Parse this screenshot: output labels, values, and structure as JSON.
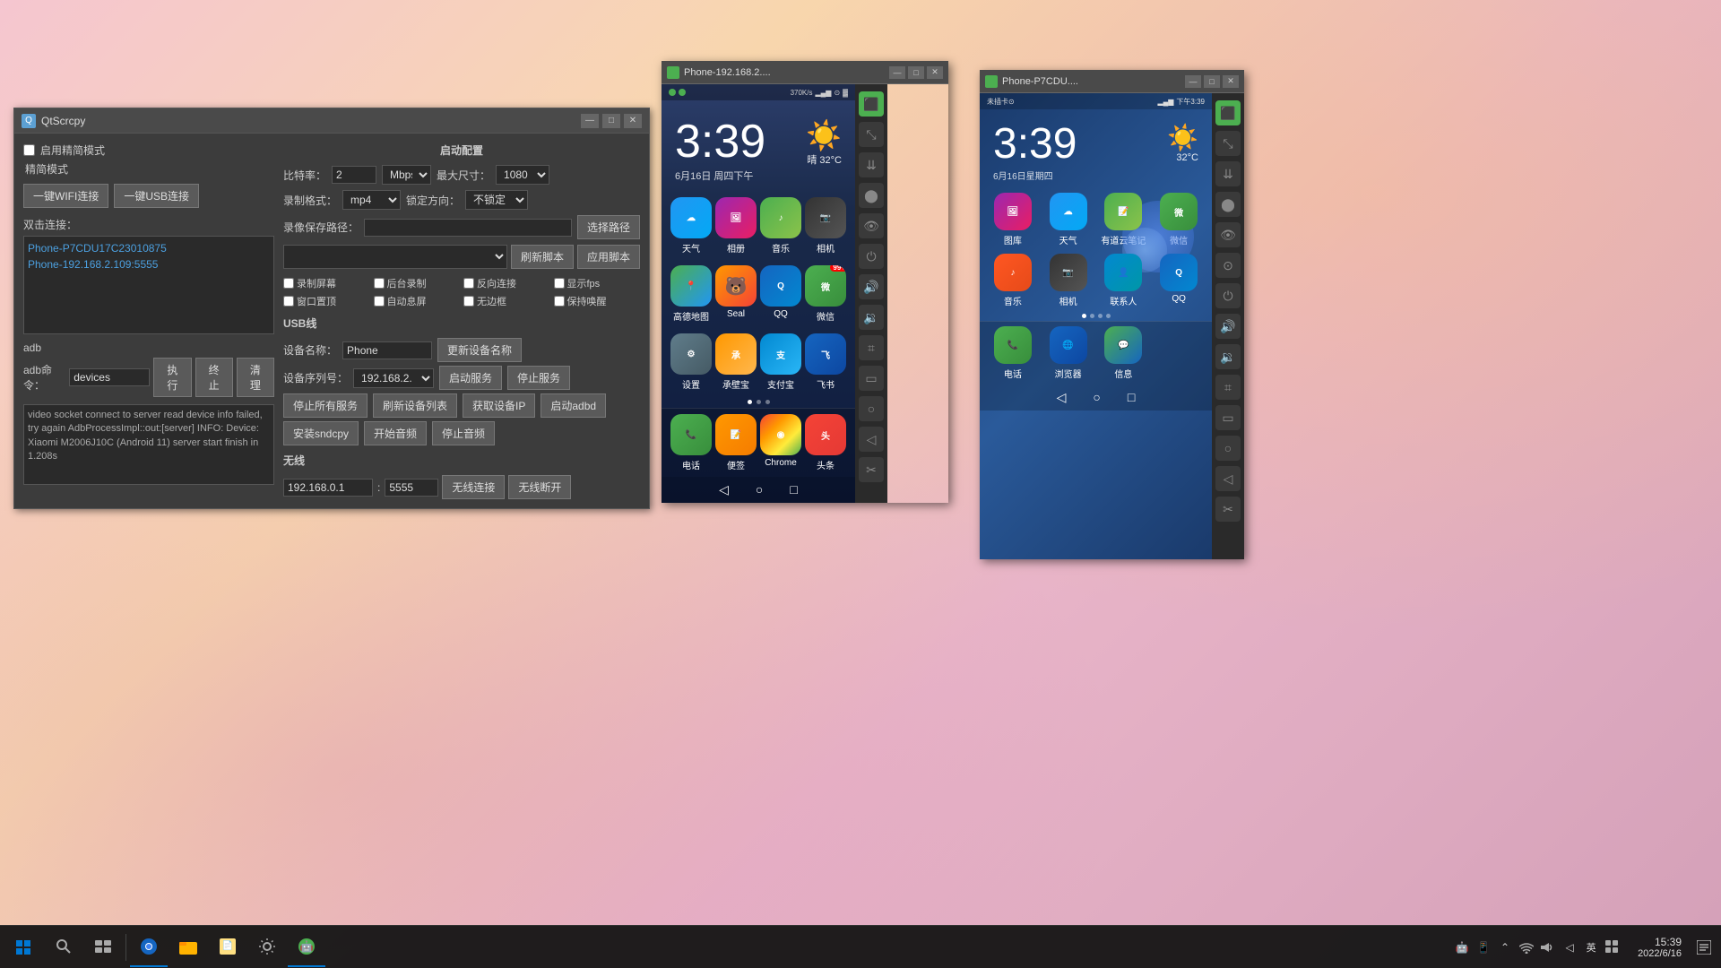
{
  "desktop": {
    "background": "pink floral gradient"
  },
  "qtscrcpy": {
    "title": "QtScrcpy",
    "enable_simple_mode_label": "启用精简模式",
    "simple_mode_label": "精简模式",
    "wifi_btn": "一键WIFI连接",
    "usb_btn": "一键USB连接",
    "dual_connect_label": "双击连接：",
    "devices": [
      "Phone-P7CDU17C23010875",
      "Phone-192.168.2.109:5555"
    ],
    "adb_label": "adb",
    "adb_cmd_label": "adb命令：",
    "adb_cmd_value": "devices",
    "execute_btn": "执行",
    "terminate_btn": "终止",
    "clear_btn": "清理",
    "log_text": "video socket connect to server read device info failed, try again\n\nAdbProcessImpl::out:[server] INFO: Device: Xiaomi M2006J10C (Android 11)\n\nserver start finish in 1.208s",
    "startup_config_title": "启动配置",
    "bitrate_label": "比特率：",
    "bitrate_value": "2",
    "bitrate_unit": "Mbps",
    "max_size_label": "最大尺寸：",
    "max_size_value": "1080",
    "record_format_label": "录制格式：",
    "record_format_value": "mp4",
    "lock_direction_label": "锁定方向：",
    "lock_direction_value": "不锁定",
    "record_path_label": "录像保存路径：",
    "choose_path_btn": "选择路径",
    "refresh_script_btn": "刷新脚本",
    "apply_script_btn": "应用脚本",
    "record_screen_label": "录制屏幕",
    "background_record_label": "后台录制",
    "reverse_connect_label": "反向连接",
    "show_fps_label": "显示fps",
    "window_top_label": "窗口置顶",
    "auto_screen_label": "自动息屏",
    "no_border_label": "无边框",
    "keep_awake_label": "保持唤醒",
    "usb_line_label": "USB线",
    "device_name_label": "设备名称：",
    "device_name_value": "Phone",
    "update_device_name_btn": "更新设备名称",
    "device_serial_label": "设备序列号：",
    "device_serial_value": "192.168.2.",
    "start_service_btn": "启动服务",
    "stop_service_btn": "停止服务",
    "stop_all_services_btn": "停止所有服务",
    "refresh_device_list_btn": "刷新设备列表",
    "get_device_ip_btn": "获取设备IP",
    "start_adbd_btn": "启动adbd",
    "install_sndcpy_btn": "安装sndcpy",
    "start_audio_btn": "开始音频",
    "stop_audio_btn": "停止音频",
    "wireless_label": "无线",
    "ip_value": "192.168.0.1",
    "port_value": "5555",
    "wireless_connect_btn": "无线连接",
    "wireless_disconnect_btn": "无线断开"
  },
  "phone1": {
    "title": "Phone-192.168.2....",
    "time": "3:39",
    "date": "6月16日 周四下午",
    "weather": "晴 32°C",
    "status_info": "370K/s",
    "apps_row1": [
      {
        "name": "天气",
        "icon": "weather"
      },
      {
        "name": "相册",
        "icon": "gallery"
      },
      {
        "name": "音乐",
        "icon": "music"
      },
      {
        "name": "相机",
        "icon": "camera"
      }
    ],
    "apps_row2": [
      {
        "name": "高德地图",
        "icon": "map"
      },
      {
        "name": "Seal",
        "icon": "bear"
      },
      {
        "name": "QQ",
        "icon": "qq"
      },
      {
        "name": "微信",
        "icon": "wechat",
        "badge": "99+"
      }
    ],
    "apps_row3": [
      {
        "name": "设置",
        "icon": "settings"
      },
      {
        "name": "承壁宝",
        "icon": "chengbao"
      },
      {
        "name": "支付宝",
        "icon": "alipay"
      },
      {
        "name": "飞书",
        "icon": "feishu"
      }
    ],
    "dock": [
      {
        "name": "电话",
        "icon": "phone"
      },
      {
        "name": "便签",
        "icon": "note"
      },
      {
        "name": "Chrome",
        "icon": "chrome"
      },
      {
        "name": "头条",
        "icon": "toutiao"
      }
    ]
  },
  "phone2": {
    "title": "Phone-P7CDU....",
    "time": "3:39",
    "date": "6月16日星期四",
    "weather": "32°C",
    "status_info": "未插卡",
    "apps_row1": [
      {
        "name": "图库",
        "icon": "gallery2"
      },
      {
        "name": "天气",
        "icon": "weather2"
      },
      {
        "name": "有道云笔记",
        "icon": "notes2"
      },
      {
        "name": "微信",
        "icon": "wechat2"
      }
    ],
    "apps_row2": [
      {
        "name": "音乐",
        "icon": "music2"
      },
      {
        "name": "相机",
        "icon": "camera2"
      },
      {
        "name": "联系人",
        "icon": "contacts2"
      },
      {
        "name": "QQ",
        "icon": "qq2"
      }
    ],
    "dock": [
      {
        "name": "电话",
        "icon": "phone2"
      },
      {
        "name": "浏览器",
        "icon": "browser2"
      },
      {
        "name": "信息",
        "icon": "msg2"
      }
    ]
  },
  "taskbar": {
    "time": "15:39",
    "date": "2022/6/16",
    "items": [
      {
        "name": "搜索",
        "icon": "search"
      },
      {
        "name": "任务视图",
        "icon": "task-view"
      },
      {
        "name": "Chrome",
        "icon": "chrome-tb"
      },
      {
        "name": "文件管理",
        "icon": "file-explorer"
      },
      {
        "name": "记事本",
        "icon": "notepad"
      },
      {
        "name": "设置",
        "icon": "settings-tb"
      },
      {
        "name": "Android调试",
        "icon": "android"
      }
    ],
    "tray": [
      {
        "name": "Android图标",
        "icon": "android-tray"
      },
      {
        "name": "网络",
        "icon": "network"
      },
      {
        "name": "隐藏图标",
        "icon": "chevron"
      },
      {
        "name": "语言",
        "icon": "lang"
      },
      {
        "name": "音量",
        "icon": "volume"
      },
      {
        "name": "通知中心",
        "icon": "notify"
      }
    ],
    "lang_label": "英"
  }
}
